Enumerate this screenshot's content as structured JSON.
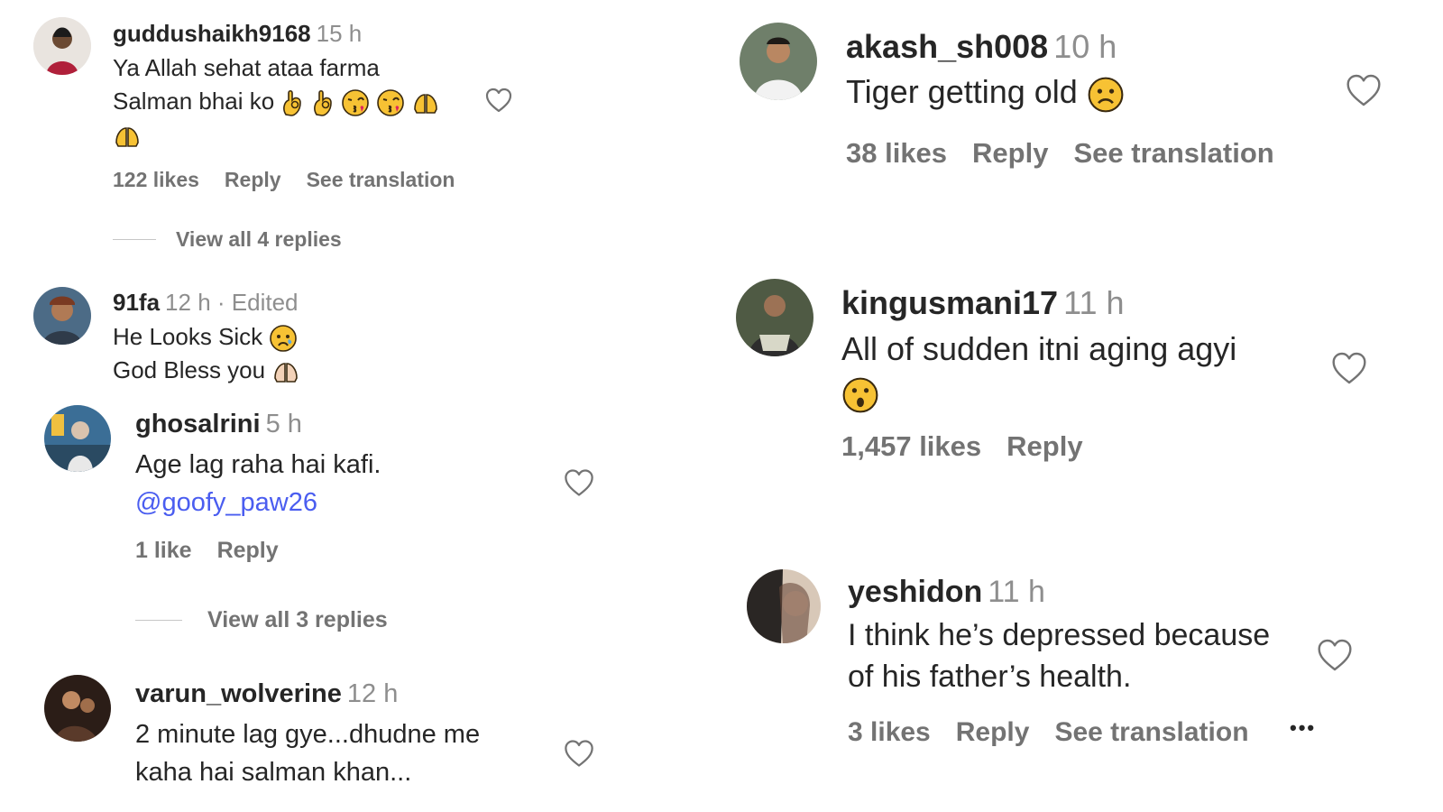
{
  "comments": [
    {
      "username": "guddushaikh9168",
      "time": "15 h",
      "lines": [
        "Ya Allah sehat ataa farma",
        "Salman bhai ko"
      ],
      "likes": "122 likes",
      "reply": "Reply",
      "translation": "See translation",
      "view_replies": "View all 4 replies",
      "emojis": [
        "ok-hand-emoji",
        "ok-hand-emoji",
        "kissing-face-emoji",
        "kissing-face-emoji",
        "folded-hands-emoji",
        "folded-hands-emoji"
      ]
    },
    {
      "username": "91fa",
      "time": "12 h",
      "edited": " · Edited",
      "line1": "He Looks Sick",
      "line2": "God Bless you",
      "emojis": [
        "crying-face-emoji",
        "folded-hands-emoji"
      ]
    },
    {
      "username": "ghosalrini",
      "time": "5 h",
      "line1": "Age lag raha hai kafi.",
      "mention": "@goofy_paw26",
      "likes": "1 like",
      "reply": "Reply",
      "view_replies": "View all 3 replies"
    },
    {
      "username": "varun_wolverine",
      "time": "12 h",
      "line1": "2 minute lag gye...dhudne me",
      "line2": "kaha hai salman khan..."
    },
    {
      "username": "akash_sh008",
      "time": "10 h",
      "line1": "Tiger getting old",
      "likes": "38 likes",
      "reply": "Reply",
      "translation": "See translation",
      "emojis": [
        "sad-face-emoji"
      ]
    },
    {
      "username": "kingusmani17",
      "time": "11 h",
      "line1": "All of sudden itni aging agyi",
      "likes": "1,457 likes",
      "reply": "Reply",
      "emojis": [
        "surprised-face-emoji"
      ]
    },
    {
      "username": "yeshidon",
      "time": "11 h",
      "line1": "I think he’s depressed because",
      "line2": "of his father’s health.",
      "likes": "3 likes",
      "reply": "Reply",
      "translation": "See translation",
      "more": "•••"
    }
  ],
  "icons": {
    "heart": "heart-outline-icon",
    "more": "more-options-icon"
  },
  "colors": {
    "text": "#262626",
    "muted": "#8e8e8e",
    "action": "#737373",
    "mention": "#4a5df0",
    "emoji": "#f7c234"
  }
}
